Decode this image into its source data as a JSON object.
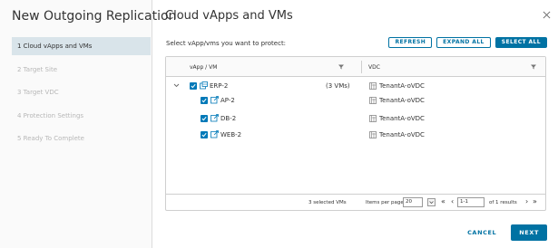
{
  "wizard": {
    "title": "New Outgoing Replication",
    "steps": [
      {
        "label": "1 Cloud vApps and VMs",
        "active": true
      },
      {
        "label": "2 Target Site",
        "active": false
      },
      {
        "label": "3 Target VDC",
        "active": false
      },
      {
        "label": "4 Protection Settings",
        "active": false
      },
      {
        "label": "5 Ready To Complete",
        "active": false
      }
    ]
  },
  "main": {
    "title": "Cloud vApps and VMs",
    "instruction": "Select vApp/vms you want to protect:",
    "buttons": {
      "refresh": "REFRESH",
      "expand_all": "EXPAND ALL",
      "select_all": "SELECT ALL"
    }
  },
  "grid": {
    "columns": {
      "vapp": "vApp / VM",
      "vdc": "VDC"
    },
    "rows": [
      {
        "name": "ERP-2",
        "count": "(3 VMs)",
        "vdc": "TenantA-oVDC",
        "type": "vapp",
        "checked": true
      },
      {
        "name": "AP-2",
        "count": "",
        "vdc": "TenantA-oVDC",
        "type": "vm",
        "checked": true
      },
      {
        "name": "DB-2",
        "count": "",
        "vdc": "TenantA-oVDC",
        "type": "vm",
        "checked": true
      },
      {
        "name": "WEB-2",
        "count": "",
        "vdc": "TenantA-oVDC",
        "type": "vm",
        "checked": true
      }
    ],
    "footer": {
      "selected": "3 selected VMs",
      "items_per_page_label": "Items per page",
      "items_per_page": "20",
      "page": "1-1",
      "of_results": "of 1 results"
    }
  },
  "footer": {
    "cancel": "CANCEL",
    "next": "NEXT"
  },
  "colors": {
    "accent": "#0072a3",
    "checkbox": "#0079b8",
    "active_step": "#d9e4ea"
  },
  "icons": [
    "close-icon",
    "filter-icon",
    "chevron-down-icon",
    "vapp-icon",
    "vm-icon",
    "datacenter-icon",
    "checkbox-checked-icon"
  ]
}
